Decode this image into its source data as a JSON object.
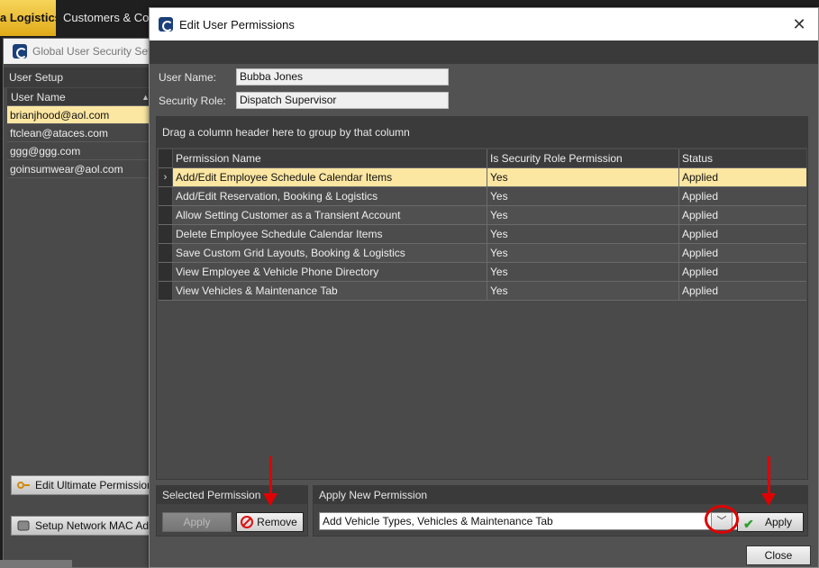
{
  "background": {
    "active_tab": "a Logistics",
    "tab2": "Customers & Cor",
    "window_title": "Global User Security Setu",
    "section_label": "User Setup",
    "grid_header": "User Name",
    "users": [
      "brianjhood@aol.com",
      "ftclean@ataces.com",
      "ggg@ggg.com",
      "goinsumwear@aol.com"
    ],
    "edit_perms_button": "Edit Ultimate  Permissions",
    "mac_button": "Setup Network MAC Addre"
  },
  "dialog": {
    "title": "Edit User Permissions",
    "close_glyph": "✕",
    "user_name_label": "User Name:",
    "user_name_value": "Bubba Jones",
    "security_role_label": "Security Role:",
    "security_role_value": "Dispatch Supervisor",
    "group_hint": "Drag a column header here to group by that column",
    "columns": [
      "Permission Name",
      "Is Security Role Permission",
      "Status"
    ],
    "rows": [
      {
        "name": "Add/Edit Employee Schedule Calendar Items",
        "role": "Yes",
        "status": "Applied"
      },
      {
        "name": "Add/Edit Reservation, Booking & Logistics",
        "role": "Yes",
        "status": "Applied"
      },
      {
        "name": "Allow Setting Customer as a Transient Account",
        "role": "Yes",
        "status": "Applied"
      },
      {
        "name": "Delete Employee Schedule Calendar Items",
        "role": "Yes",
        "status": "Applied"
      },
      {
        "name": "Save Custom Grid Layouts, Booking & Logistics",
        "role": "Yes",
        "status": "Applied"
      },
      {
        "name": "View Employee & Vehicle Phone Directory",
        "role": "Yes",
        "status": "Applied"
      },
      {
        "name": "View Vehicles & Maintenance Tab",
        "role": "Yes",
        "status": "Applied"
      }
    ],
    "selected_row_indicator": "›",
    "selected_panel_title": "Selected Permission",
    "apply_button_disabled": "Apply",
    "remove_button": "Remove",
    "apply_panel_title": "Apply New Permission",
    "new_permission_value": "Add Vehicle Types, Vehicles & Maintenance Tab",
    "dropdown_glyph": "﹀",
    "apply_button": "Apply",
    "close_button": "Close"
  },
  "colors": {
    "selection": "#fbe6a2",
    "annotation": "#e00000",
    "accent_tab": "#f0c030"
  }
}
